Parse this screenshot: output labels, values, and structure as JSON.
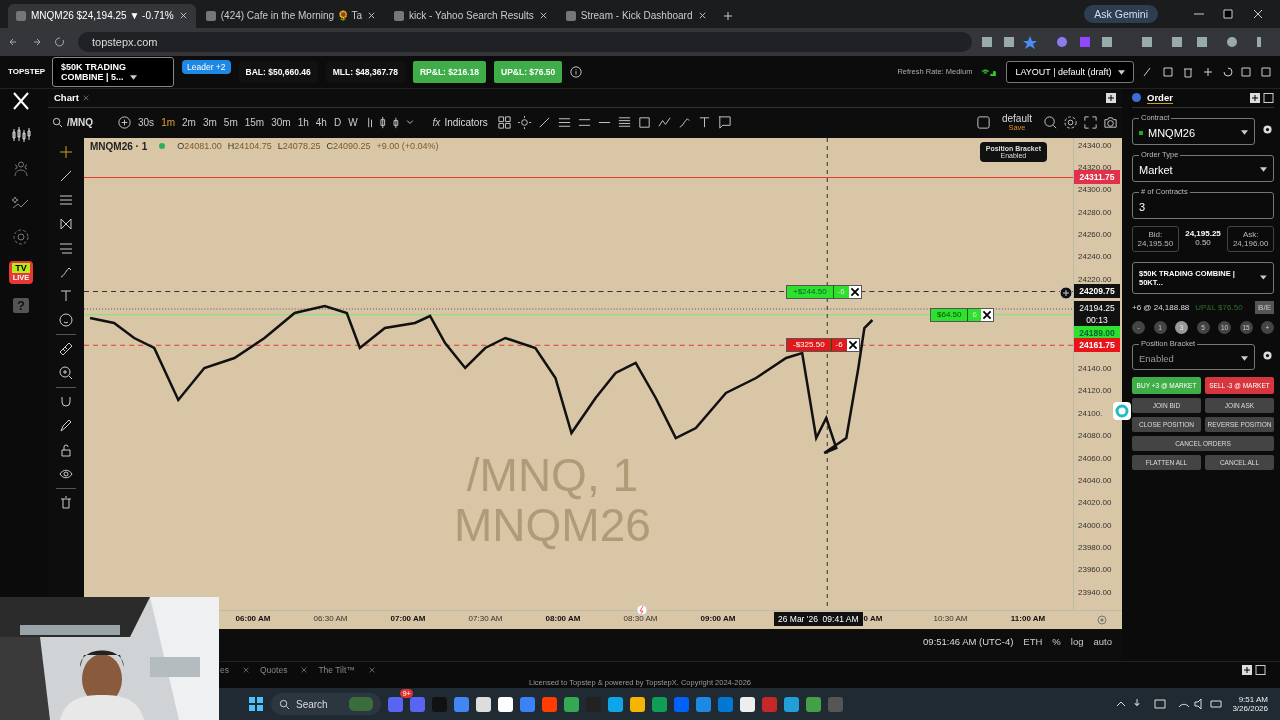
{
  "browser": {
    "tabs": [
      {
        "title": "MNQM26 $24,194.25 ▼ -0.71%",
        "selected": true
      },
      {
        "title": "(424) Cafe in the Morning 🌻 Ta",
        "selected": false
      },
      {
        "title": "kick - Yahoo Search Results",
        "selected": false
      },
      {
        "title": "Stream - Kick Dashboard",
        "selected": false
      }
    ],
    "ask_button": "Ask Gemini",
    "url": "topstepx.com"
  },
  "header": {
    "logo": "TOPSTEP",
    "account": "$50K TRADING COMBINE | 5...",
    "leader_badge": "Leader +2",
    "stats": [
      {
        "text": "BAL: $50,660.46",
        "kind": "plain"
      },
      {
        "text": "MLL: $48,367.78",
        "kind": "plain"
      },
      {
        "text": "RP&L: $216.18",
        "kind": "positive"
      },
      {
        "text": "UP&L: $76.50",
        "kind": "positive"
      }
    ],
    "refresh_rate": "Refresh Rate: Medium",
    "layout": "LAYOUT | default (draft)"
  },
  "nav": {
    "tv_badge": "TV",
    "live_badge": "LIVE",
    "help": "?"
  },
  "chart_panel": {
    "tab": "Chart",
    "symbol_search": "/MNQ",
    "intervals": [
      {
        "label": "30s",
        "selected": false
      },
      {
        "label": "1m",
        "selected": true
      },
      {
        "label": "2m",
        "selected": false
      },
      {
        "label": "3m",
        "selected": false
      },
      {
        "label": "5m",
        "selected": false
      },
      {
        "label": "15m",
        "selected": false
      },
      {
        "label": "30m",
        "selected": false
      },
      {
        "label": "1h",
        "selected": false
      },
      {
        "label": "4h",
        "selected": false
      },
      {
        "label": "D",
        "selected": false
      },
      {
        "label": "W",
        "selected": false
      }
    ],
    "indicators_icon": "fx",
    "indicators": "Indicators",
    "template": "default",
    "template_action": "Save",
    "legend": {
      "title": "MNQM26 · 1",
      "ohlc": [
        {
          "label": "O",
          "value": "24081.00"
        },
        {
          "label": "H",
          "value": "24104.75"
        },
        {
          "label": "L",
          "value": "24078.25"
        },
        {
          "label": "C",
          "value": "24090.25"
        }
      ],
      "change": "+9.00 (+0.04%)"
    },
    "watermark": [
      "/MNQ, 1",
      "MNQM26"
    ],
    "bracket_tooltip": {
      "title": "Position Bracket",
      "status": "Enabled"
    },
    "price_ticks": [
      "24340.00",
      "24320.00",
      "24300.00",
      "24280.00",
      "24260.00",
      "24240.00",
      "24220.00",
      "24140.00",
      "24120.00",
      "24100.",
      "24080.00",
      "24060.00",
      "24040.00",
      "24020.00",
      "24000.00",
      "23980.00",
      "23960.00",
      "23940.00"
    ],
    "price_labels": [
      {
        "text": "24311.75",
        "kind": "alert"
      },
      {
        "text": "24209.75",
        "kind": "crosshair"
      },
      {
        "text": "24194.25",
        "kind": "last",
        "countdown": "00:13"
      },
      {
        "text": "24189.00",
        "kind": "position"
      },
      {
        "text": "24161.75",
        "kind": "stop"
      }
    ],
    "orders": [
      {
        "kind": "target",
        "pnl": "+$244.50",
        "qty": "-6"
      },
      {
        "kind": "stop",
        "pnl": "-$325.50",
        "qty": "-6"
      },
      {
        "kind": "position",
        "pnl": "$64.50",
        "qty": "6"
      }
    ],
    "time_ticks": [
      {
        "label": "06:00 AM",
        "major": true
      },
      {
        "label": "06:30 AM",
        "major": false
      },
      {
        "label": "07:00 AM",
        "major": true
      },
      {
        "label": "07:30 AM",
        "major": false
      },
      {
        "label": "08:00 AM",
        "major": true
      },
      {
        "label": "08:30 AM",
        "major": false
      },
      {
        "label": "09:00 AM",
        "major": true
      },
      {
        "label": "0 AM",
        "major": true
      },
      {
        "label": "10:30 AM",
        "major": false
      },
      {
        "label": "11:00 AM",
        "major": true
      }
    ],
    "crosshair_date": "26 Mar '26",
    "crosshair_time": "09:41 AM",
    "footer": {
      "time": "09:51:46 AM (UTC-4)",
      "session": "ETH",
      "percent": "%",
      "log": "log",
      "auto": "auto"
    }
  },
  "order_panel": {
    "tab": "Order",
    "contract_label": "Contract",
    "contract": "MNQM26",
    "order_type_label": "Order Type",
    "order_type": "Market",
    "contracts_label": "# of Contracts",
    "contracts": "3",
    "bid_label": "Bid:",
    "bid": "24,195.50",
    "last": "24,195.25",
    "spread": "0.50",
    "ask_label": "Ask:",
    "ask": "24,196.00",
    "account": "$50K TRADING COMBINE | 50KT...",
    "position": "+6 @ 24,188.88",
    "upnl": "UP&L $76.50",
    "breakeven": "B/E",
    "decrement": "-",
    "increment": "+",
    "quantities": [
      {
        "label": "1",
        "selected": false
      },
      {
        "label": "3",
        "selected": true
      },
      {
        "label": "5",
        "selected": false
      },
      {
        "label": "10",
        "selected": false
      },
      {
        "label": "15",
        "selected": false
      }
    ],
    "bracket_label": "Position Bracket",
    "bracket": "Enabled",
    "buttons": [
      {
        "label": "BUY +3 @ MARKET",
        "kind": "buy"
      },
      {
        "label": "SELL -3 @ MARKET",
        "kind": "sell"
      },
      {
        "label": "JOIN BID",
        "kind": "normal"
      },
      {
        "label": "JOIN ASK",
        "kind": "normal"
      },
      {
        "label": "CLOSE POSITION",
        "kind": "normal"
      },
      {
        "label": "REVERSE POSITION",
        "kind": "normal"
      },
      {
        "label": "CANCEL ORDERS",
        "kind": "wide"
      },
      {
        "label": "FLATTEN ALL",
        "kind": "normal"
      },
      {
        "label": "CANCEL ALL",
        "kind": "normal"
      }
    ]
  },
  "bottom_tabs": [
    "es",
    "Quotes",
    "The Tilt™"
  ],
  "license": "Licensed to Topstep & powered by TopstepX. Copyright 2024-2026",
  "taskbar": {
    "search": "Search",
    "chat_badge": "9+",
    "time": "9:51 AM",
    "date": "3/26/2026"
  },
  "webcam": {
    "kind": "picture"
  }
}
